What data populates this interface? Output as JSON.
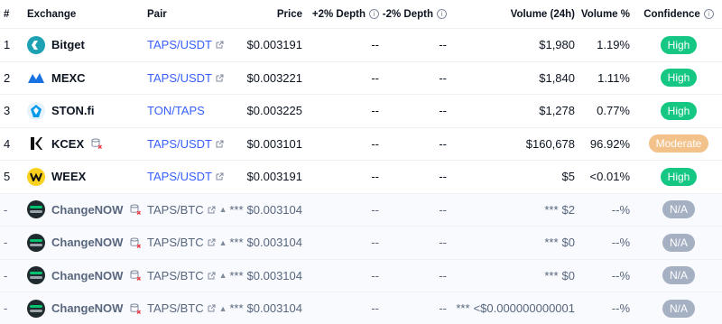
{
  "header": {
    "rank": "#",
    "exchange": "Exchange",
    "pair": "Pair",
    "price": "Price",
    "depth_plus": "+2% Depth",
    "depth_minus": "-2% Depth",
    "volume": "Volume (24h)",
    "volume_pct": "Volume %",
    "confidence": "Confidence"
  },
  "rows": [
    {
      "rank": "1",
      "exchange": "Bitget",
      "pair": "TAPS/USDT",
      "price": "$0.003191",
      "depth_plus": "--",
      "depth_minus": "--",
      "volume": "$1,980",
      "volume_pct": "1.19%",
      "confidence": "High"
    },
    {
      "rank": "2",
      "exchange": "MEXC",
      "pair": "TAPS/USDT",
      "price": "$0.003221",
      "depth_plus": "--",
      "depth_minus": "--",
      "volume": "$1,840",
      "volume_pct": "1.11%",
      "confidence": "High"
    },
    {
      "rank": "3",
      "exchange": "STON.fi",
      "pair": "TON/TAPS",
      "price": "$0.003225",
      "depth_plus": "--",
      "depth_minus": "--",
      "volume": "$1,278",
      "volume_pct": "0.77%",
      "confidence": "High"
    },
    {
      "rank": "4",
      "exchange": "KCEX",
      "pair": "TAPS/USDT",
      "price": "$0.003101",
      "depth_plus": "--",
      "depth_minus": "--",
      "volume": "$160,678",
      "volume_pct": "96.92%",
      "confidence": "Moderate"
    },
    {
      "rank": "5",
      "exchange": "WEEX",
      "pair": "TAPS/USDT",
      "price": "$0.003191",
      "depth_plus": "--",
      "depth_minus": "--",
      "volume": "$5",
      "volume_pct": "<0.01%",
      "confidence": "High"
    },
    {
      "rank": "-",
      "exchange": "ChangeNOW",
      "pair": "TAPS/BTC",
      "price_prefix": "***",
      "price": "$0.003104",
      "depth_plus": "--",
      "depth_minus": "--",
      "volume_prefix": "***",
      "volume": "$2",
      "volume_pct": "--%",
      "confidence": "N/A"
    },
    {
      "rank": "-",
      "exchange": "ChangeNOW",
      "pair": "TAPS/BTC",
      "price_prefix": "***",
      "price": "$0.003104",
      "depth_plus": "--",
      "depth_minus": "--",
      "volume_prefix": "***",
      "volume": "$0",
      "volume_pct": "--%",
      "confidence": "N/A"
    },
    {
      "rank": "-",
      "exchange": "ChangeNOW",
      "pair": "TAPS/BTC",
      "price_prefix": "***",
      "price": "$0.003104",
      "depth_plus": "--",
      "depth_minus": "--",
      "volume_prefix": "***",
      "volume": "$0",
      "volume_pct": "--%",
      "confidence": "N/A"
    },
    {
      "rank": "-",
      "exchange": "ChangeNOW",
      "pair": "TAPS/BTC",
      "price_prefix": "***",
      "price": "$0.003104",
      "depth_plus": "--",
      "depth_minus": "--",
      "volume_prefix": "***",
      "volume": "<$0.000000000001",
      "volume_pct": "--%",
      "confidence": "N/A"
    }
  ],
  "colors": {
    "high": "#16c784",
    "moderate": "#f3c28b",
    "na": "#a6b0c3",
    "link": "#3861fb"
  }
}
